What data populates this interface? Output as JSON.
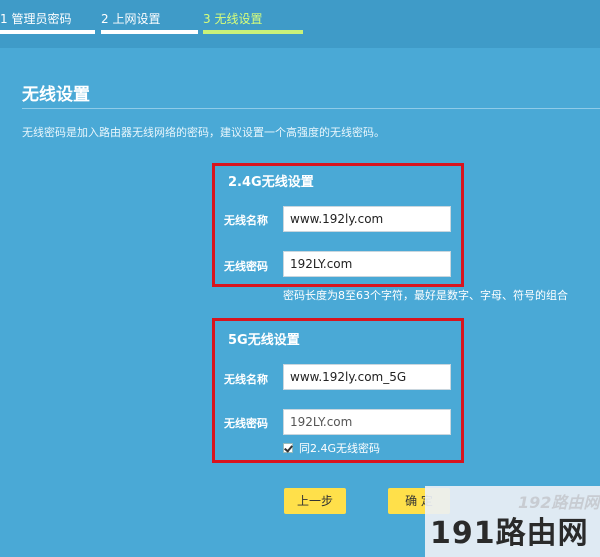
{
  "steps": [
    {
      "label": "1 管理员密码"
    },
    {
      "label": "2 上网设置"
    },
    {
      "label": "3 无线设置"
    }
  ],
  "page": {
    "title": "无线设置",
    "description": "无线密码是加入路由器无线网络的密码，建议设置一个高强度的无线密码。"
  },
  "wifi24": {
    "title": "2.4G无线设置",
    "name_label": "无线名称",
    "name_value": "www.192ly.com",
    "password_label": "无线密码",
    "password_value": "192LY.com",
    "hint": "密码长度为8至63个字符，最好是数字、字母、符号的组合"
  },
  "wifi5": {
    "title": "5G无线设置",
    "name_label": "无线名称",
    "name_value": "www.192ly.com_5G",
    "password_label": "无线密码",
    "password_value": "192LY.com",
    "same_password_label": "同2.4G无线密码",
    "same_password_checked": true
  },
  "buttons": {
    "prev": "上一步",
    "confirm": "确 定"
  },
  "watermark": {
    "top": "192路由网",
    "main": "191路由网"
  },
  "colors": {
    "background": "#4aa9d6",
    "highlight_box": "#d8141e",
    "button": "#ffe04a",
    "active_step": "#c9f27a"
  }
}
